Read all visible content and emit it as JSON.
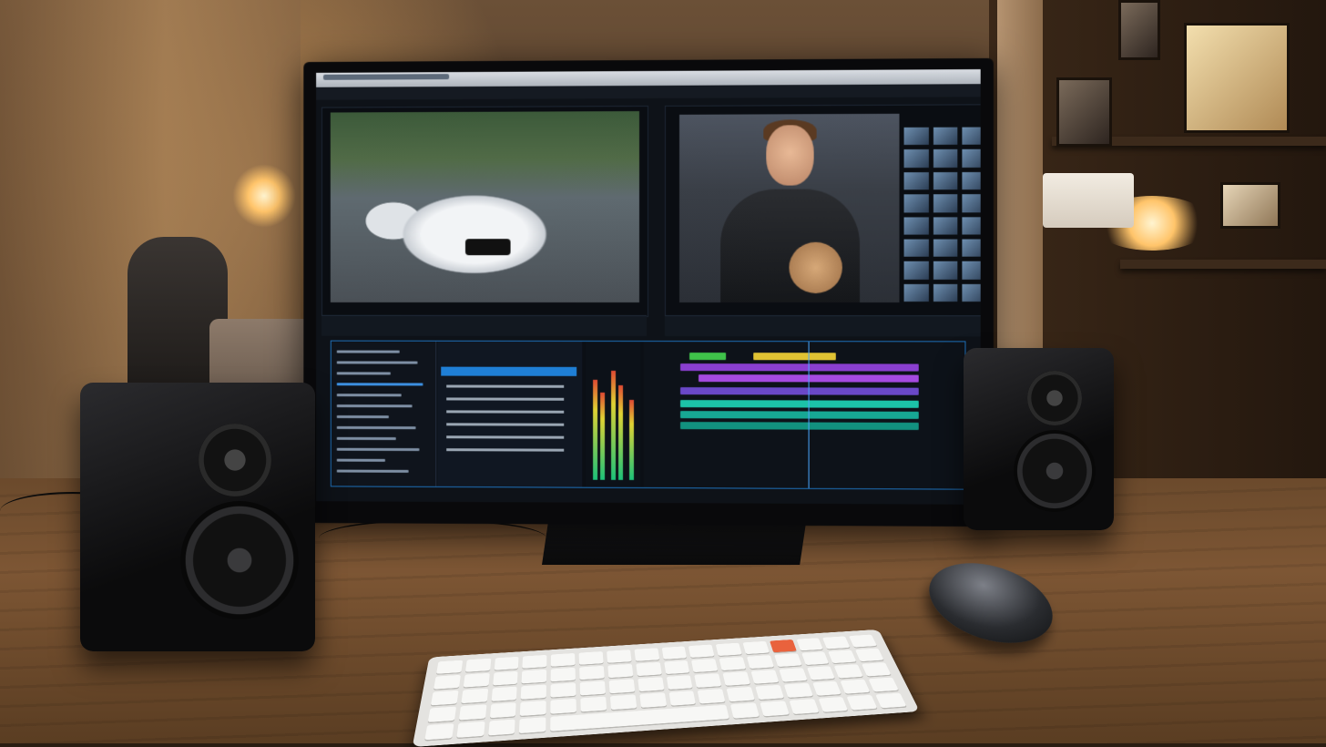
{
  "scene": {
    "description_colors": {
      "accent": "#1f7fd6",
      "clip_purple": "#8a3fd0",
      "clip_teal": "#1cc2a8",
      "clip_green": "#3fc24a",
      "lamp": "#ffc46a"
    }
  },
  "editor": {
    "window_title": "",
    "menu_text": "",
    "timecode": "",
    "viewer_left_icon": "car-frame",
    "viewer_right_icon": "interview-frame"
  }
}
